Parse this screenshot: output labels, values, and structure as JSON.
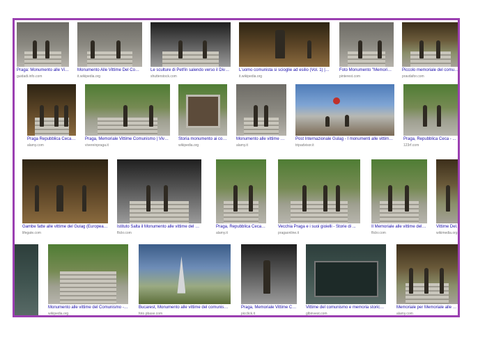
{
  "tiles": [
    {
      "caption": "Praga: Monumento alle Vitt...",
      "source": "guidadi.info.com",
      "style": "t-stone"
    },
    {
      "caption": "Monumento Alle Vittime Del Comu...",
      "source": "it.wikipedia.org",
      "style": "t-stone"
    },
    {
      "caption": "Le sculture di Petřín salendo verso il Divadlo...",
      "source": "shutterstock.com",
      "style": "t-bw"
    },
    {
      "caption": "L'uomo comunista si scioglie ad esilio (Vol. 1) | Ritro...",
      "source": "it.wikipedia.org",
      "style": "t-bronze"
    },
    {
      "caption": "Foto Monumento \"Memoriale di...",
      "source": "pinterest.com",
      "style": "t-stone"
    },
    {
      "caption": "Piccolo memoriale del comunismo d...",
      "source": "pravdafor.com",
      "style": "t-autumn"
    },
    {
      "caption": "Praga Repubblica Ceca M...",
      "source": "alamy.com",
      "style": "t-bronze"
    },
    {
      "caption": "Praga, Memoriale Vittime Comunismo | Viver...",
      "source": "vivereinpraga.it",
      "style": "t-green"
    },
    {
      "caption": "Storia monumento ai comunisti...",
      "source": "wikipedia.org",
      "style": "t-green"
    },
    {
      "caption": "Monumento alle vittime del...",
      "source": "alamy.it",
      "style": "t-stone"
    },
    {
      "caption": "Post Internazionale Gulag - I monumenti alle vittime del...",
      "source": "tripadvisor.it",
      "style": "t-city"
    },
    {
      "caption": "Praga, Repubblica Ceca - ...",
      "source": "123rf.com",
      "style": "t-green"
    },
    {
      "caption": "Gambe fatte alle vittime del Gulag (Europea in crescita)",
      "source": "lifegate.com",
      "style": "t-bronze"
    },
    {
      "caption": "Istituto Salta il Monumento alle vittime del com...",
      "source": "flickr.com",
      "style": "t-bw"
    },
    {
      "caption": "Praga, Repubblica Ceca - 20...",
      "source": "alamy.it",
      "style": "t-green"
    },
    {
      "caption": "Vecchia Praga e i suoi gioielli - Storie di ...",
      "source": "pragaonline.it",
      "style": "t-green"
    },
    {
      "caption": "Il Memoriale alle vittime del co...",
      "source": "flickr.com",
      "style": "t-green"
    },
    {
      "caption": "Vittime Del...",
      "source": "wikimedia.org",
      "style": "t-autumn"
    },
    {
      "caption": "",
      "source": "",
      "style": "t-wall"
    },
    {
      "caption": "Monumento alle vittime del Comunismo - Wiki...",
      "source": "wikipedia.org",
      "style": "t-green"
    },
    {
      "caption": "Bucarest, Monumento alle vittime del comunismo R...",
      "source": "foto.pbase.com",
      "style": "t-sky"
    },
    {
      "caption": "Praga, Memoriale Vittime Co...",
      "source": "picclick.it",
      "style": "t-bw"
    },
    {
      "caption": "Vittime del comunismo e memoria storica di...",
      "source": "glbinvest.com",
      "style": "t-wall"
    },
    {
      "caption": "Memoriale per Memoriale alle vi...",
      "source": "alamy.com",
      "style": "t-autumn"
    }
  ]
}
